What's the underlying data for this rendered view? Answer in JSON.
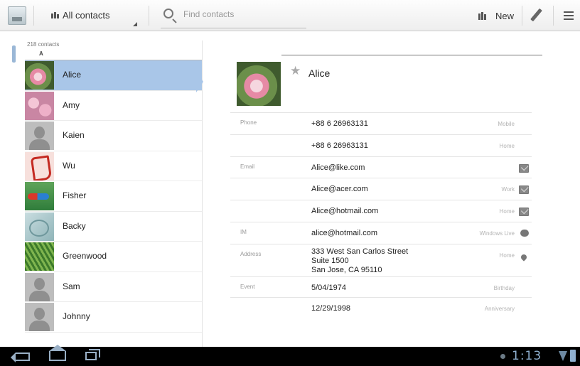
{
  "toolbar": {
    "filter_label": "All contacts",
    "search_placeholder": "Find contacts",
    "new_label": "New"
  },
  "list": {
    "count": "218 contacts",
    "section": "A",
    "contacts": [
      {
        "name": "Alice",
        "photo": "flower",
        "selected": true
      },
      {
        "name": "Amy",
        "photo": "blossom"
      },
      {
        "name": "Kaien",
        "photo": "default"
      },
      {
        "name": "Wu",
        "photo": "calligraphy"
      },
      {
        "name": "Fisher",
        "photo": "fish"
      },
      {
        "name": "Backy",
        "photo": "abstract"
      },
      {
        "name": "Greenwood",
        "photo": "grass"
      },
      {
        "name": "Sam",
        "photo": "default"
      },
      {
        "name": "Johnny",
        "photo": "default"
      }
    ]
  },
  "detail": {
    "name": "Alice",
    "fields": [
      {
        "kind": "Phone",
        "value": "+88 6 26963131",
        "sub": "Mobile",
        "action": ""
      },
      {
        "kind": "",
        "value": "+88 6 26963131",
        "sub": "Home",
        "action": ""
      },
      {
        "kind": "Email",
        "value": "Alice@like.com",
        "sub": "",
        "action": "mail-icon"
      },
      {
        "kind": "",
        "value": "Alice@acer.com",
        "sub": "Work",
        "action": "mail-icon"
      },
      {
        "kind": "",
        "value": "Alice@hotmail.com",
        "sub": "Home",
        "action": "mail-icon"
      },
      {
        "kind": "IM",
        "value": "alice@hotmail.com",
        "sub": "Windows Live",
        "action": "chat-icon"
      },
      {
        "kind": "Address",
        "value": "333 West San Carlos Street\nSuite 1500\nSan Jose, CA 95110",
        "sub": "Home",
        "action": "map-pin-icon"
      },
      {
        "kind": "Event",
        "value": "5/04/1974",
        "sub": "Birthday",
        "action": ""
      },
      {
        "kind": "",
        "value": "12/29/1998",
        "sub": "Anniversary",
        "action": ""
      }
    ]
  },
  "status": {
    "time": "1:13"
  },
  "colors": {
    "selection": "#a9c6e8",
    "system_accent": "#8fb0d0"
  }
}
